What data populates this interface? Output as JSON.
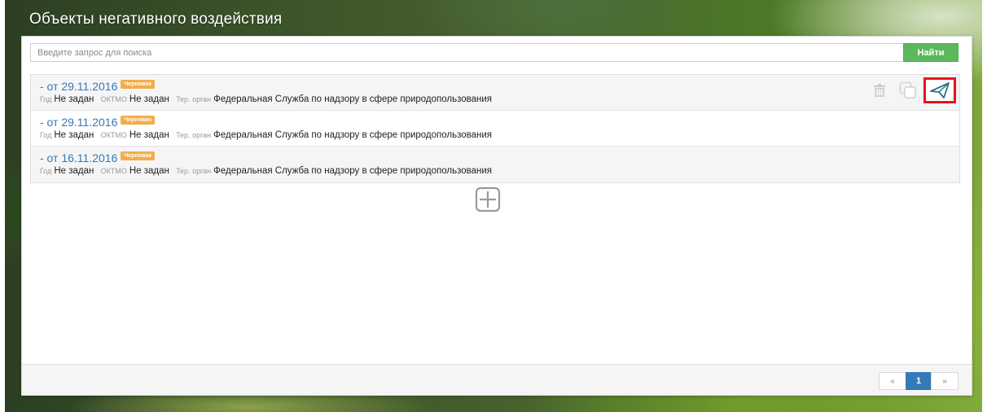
{
  "page": {
    "title": "Объекты негативного воздействия"
  },
  "search": {
    "placeholder": "Введите запрос для поиска",
    "value": "",
    "button_label": "Найти"
  },
  "colors": {
    "accent": "#337ab7",
    "success": "#5cb85c",
    "badge": "#f0ad4e",
    "highlight": "#e8141a"
  },
  "items": [
    {
      "title": "- от 29.11.2016",
      "badge": "Черновик",
      "meta": {
        "year_label": "Год",
        "year_value": "Не задан",
        "oktmo_label": "ОКТМО",
        "oktmo_value": "Не задан",
        "organ_label": "Тер. орган",
        "organ_value": "Федеральная Служба по надзору в сфере природопользования"
      },
      "actions": [
        "trash-icon",
        "copy-icon",
        "send-icon"
      ]
    },
    {
      "title": "- от 29.11.2016",
      "badge": "Черновик",
      "meta": {
        "year_label": "Год",
        "year_value": "Не задан",
        "oktmo_label": "ОКТМО",
        "oktmo_value": "Не задан",
        "organ_label": "Тер. орган",
        "organ_value": "Федеральная Служба по надзору в сфере природопользования"
      }
    },
    {
      "title": "- от 16.11.2016",
      "badge": "Черновик",
      "meta": {
        "year_label": "Год",
        "year_value": "Не задан",
        "oktmo_label": "ОКТМО",
        "oktmo_value": "Не задан",
        "organ_label": "Тер. орган",
        "organ_value": "Федеральная Служба по надзору в сфере природопользования"
      }
    }
  ],
  "add_button": {
    "icon": "plus-square-icon"
  },
  "pagination": {
    "prev": "«",
    "current": "1",
    "next": "»"
  }
}
